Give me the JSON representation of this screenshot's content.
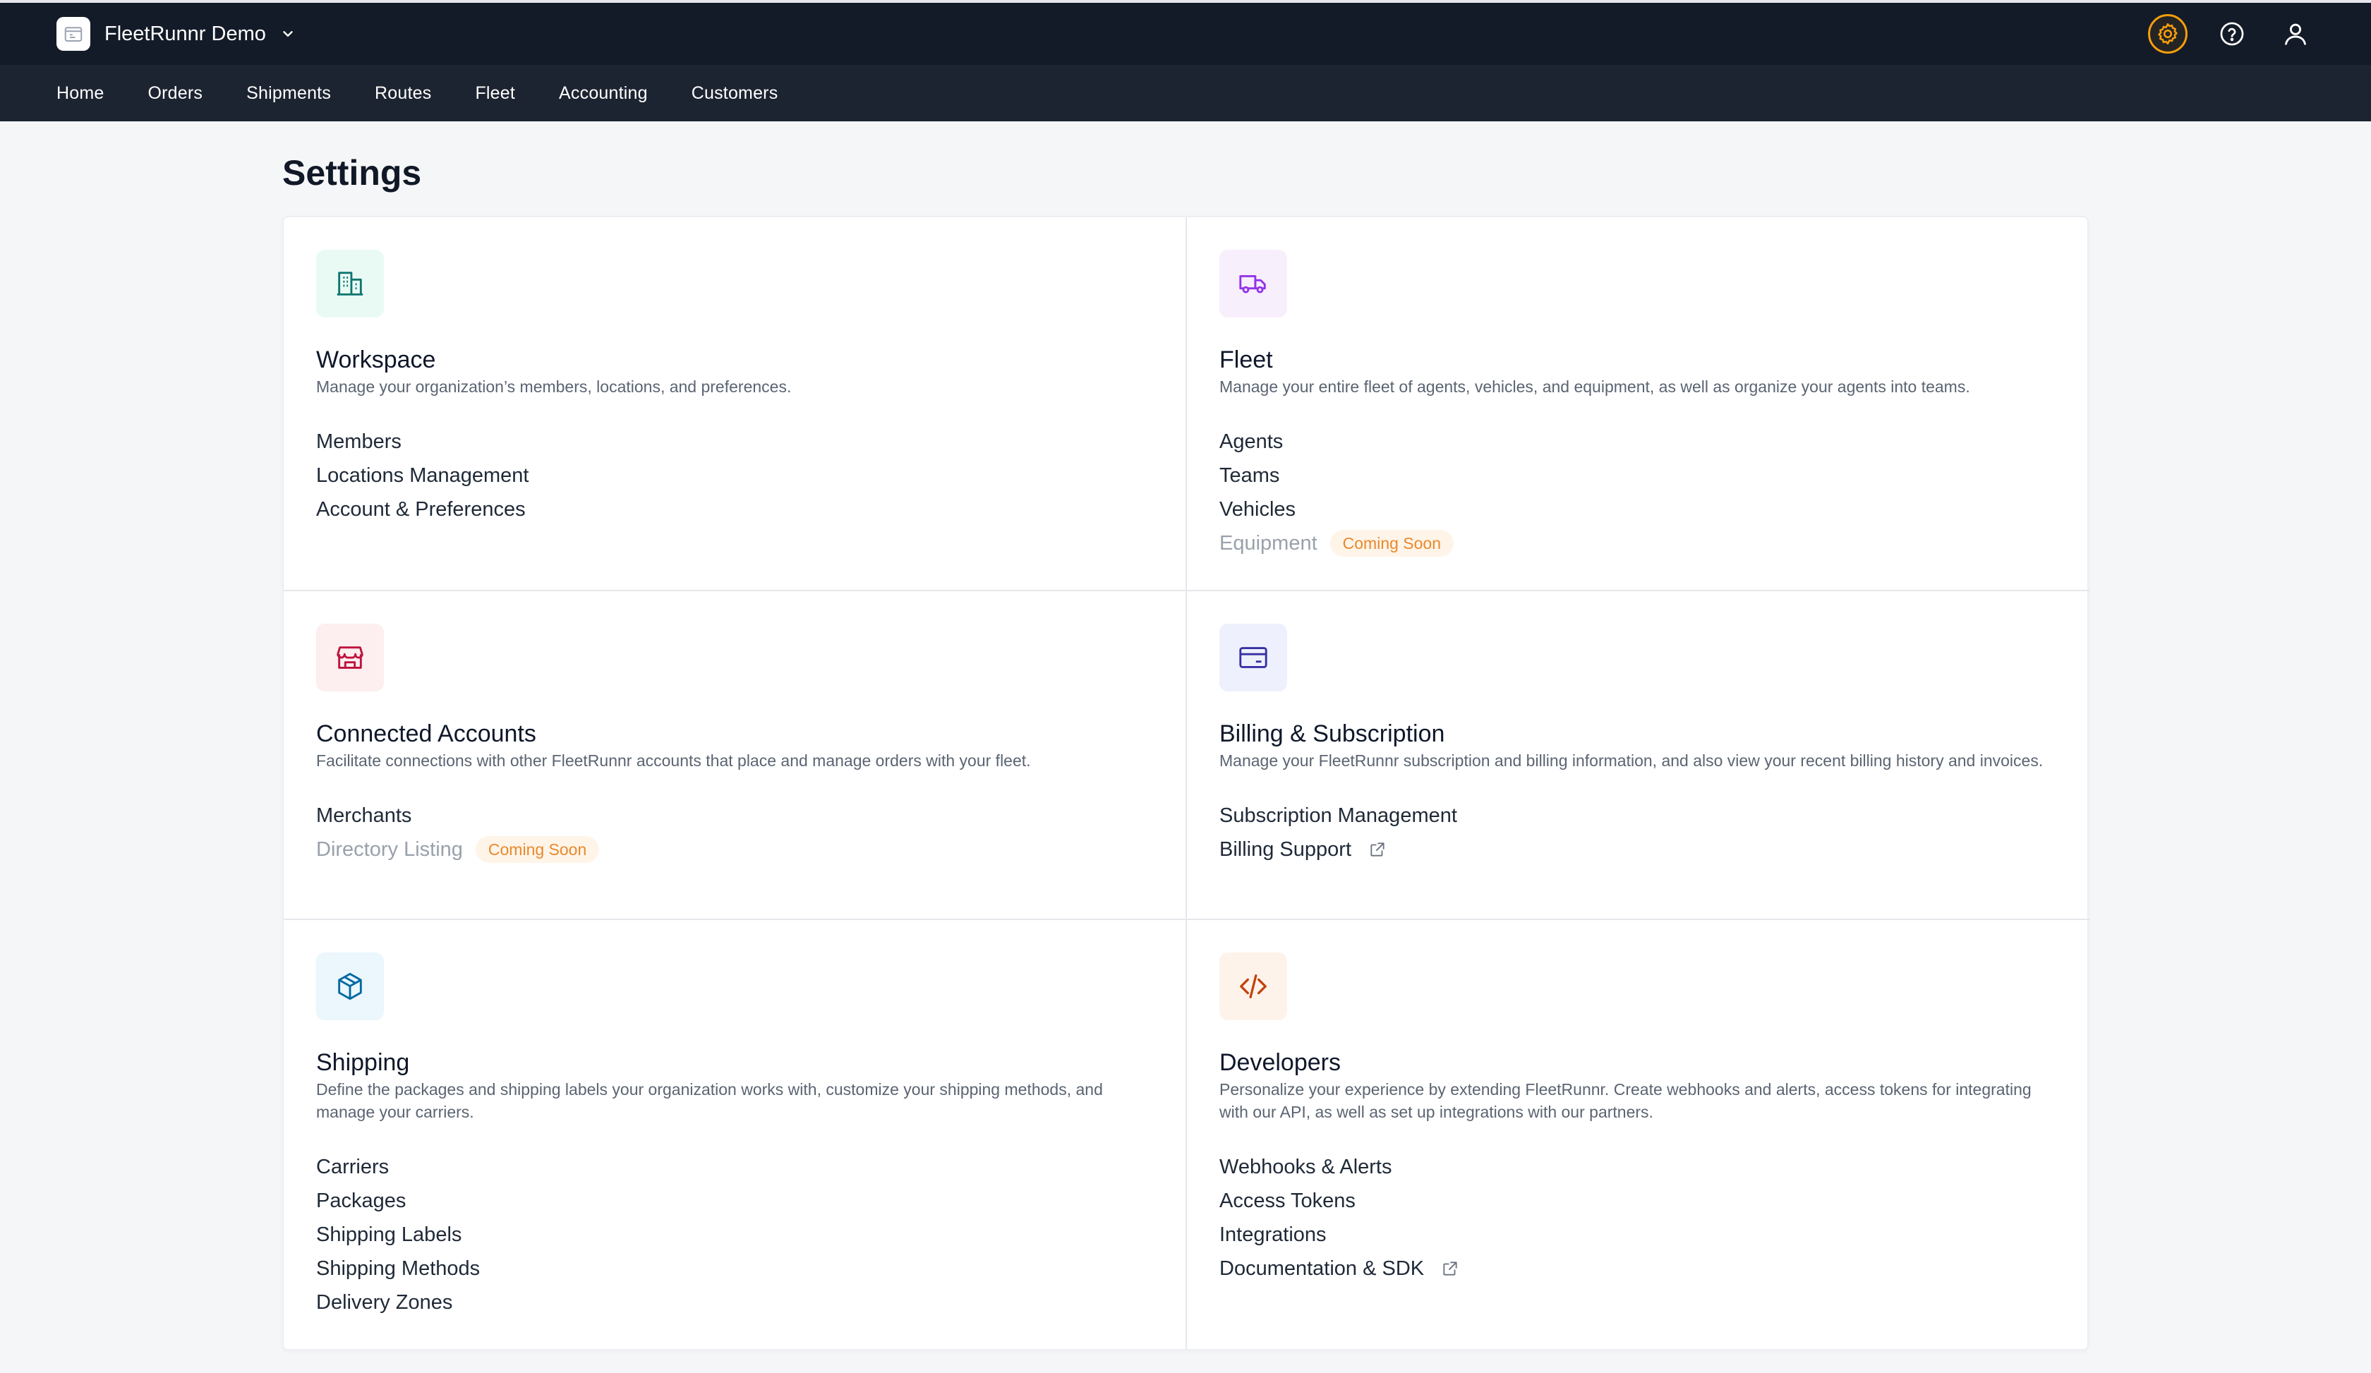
{
  "header": {
    "org_name": "FleetRunnr Demo"
  },
  "nav": {
    "items": [
      {
        "label": "Home"
      },
      {
        "label": "Orders"
      },
      {
        "label": "Shipments"
      },
      {
        "label": "Routes"
      },
      {
        "label": "Fleet"
      },
      {
        "label": "Accounting"
      },
      {
        "label": "Customers"
      }
    ]
  },
  "page": {
    "title": "Settings"
  },
  "colors": {
    "topbar": "#141b28",
    "navbar": "#1d2431",
    "accent": "#f59e0b",
    "badge_text": "#e8892c"
  },
  "sections": {
    "workspace": {
      "icon": "building-icon",
      "title": "Workspace",
      "description": "Manage your organization’s members, locations, and preferences.",
      "links": [
        {
          "label": "Members"
        },
        {
          "label": "Locations Management"
        },
        {
          "label": "Account & Preferences"
        }
      ]
    },
    "fleet": {
      "icon": "truck-icon",
      "title": "Fleet",
      "description": "Manage your entire fleet of agents, vehicles, and equipment, as well as organize your agents into teams.",
      "links": [
        {
          "label": "Agents"
        },
        {
          "label": "Teams"
        },
        {
          "label": "Vehicles"
        },
        {
          "label": "Equipment",
          "badge": "Coming Soon"
        }
      ]
    },
    "connected": {
      "icon": "storefront-icon",
      "title": "Connected Accounts",
      "description": "Facilitate connections with other FleetRunnr accounts that place and manage orders with your fleet.",
      "links": [
        {
          "label": "Merchants"
        },
        {
          "label": "Directory Listing",
          "badge": "Coming Soon"
        }
      ]
    },
    "billing": {
      "icon": "credit-card-icon",
      "title": "Billing & Subscription",
      "description": "Manage your FleetRunnr subscription and billing information, and also view your recent billing history and invoices.",
      "links": [
        {
          "label": "Subscription Management"
        },
        {
          "label": "Billing Support"
        }
      ]
    },
    "shipping": {
      "icon": "package-icon",
      "title": "Shipping",
      "description": "Define the packages and shipping labels your organization works with, customize your shipping methods, and manage your carriers.",
      "links": [
        {
          "label": "Carriers"
        },
        {
          "label": "Packages"
        },
        {
          "label": "Shipping Labels"
        },
        {
          "label": "Shipping Methods"
        },
        {
          "label": "Delivery Zones"
        }
      ]
    },
    "developers": {
      "icon": "code-icon",
      "title": "Developers",
      "description": "Personalize your experience by extending FleetRunnr. Create webhooks and alerts, access tokens for integrating with our API, as well as set up integrations with our partners.",
      "links": [
        {
          "label": "Webhooks & Alerts"
        },
        {
          "label": "Access Tokens"
        },
        {
          "label": "Integrations"
        },
        {
          "label": "Documentation & SDK"
        }
      ]
    }
  }
}
